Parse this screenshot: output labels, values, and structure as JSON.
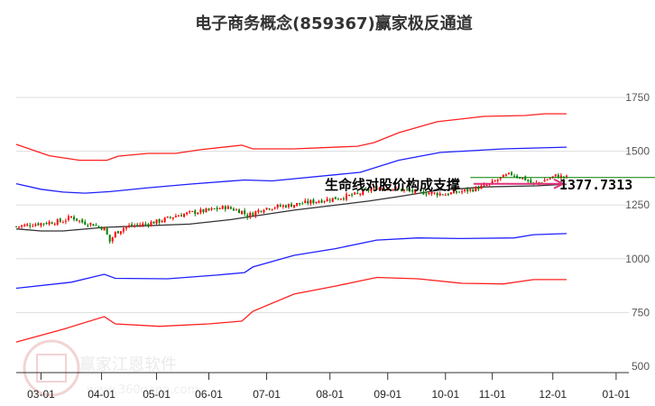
{
  "chart_data": {
    "type": "line",
    "title": "电子商务概念(859367)赢家极反通道",
    "x_unit": "trading day index",
    "x_ticks": [
      {
        "label": "03-01",
        "x": 9
      },
      {
        "label": "04-01",
        "x": 31
      },
      {
        "label": "05-01",
        "x": 51
      },
      {
        "label": "06-01",
        "x": 70
      },
      {
        "label": "07-01",
        "x": 91
      },
      {
        "label": "08-01",
        "x": 114
      },
      {
        "label": "09-01",
        "x": 135
      },
      {
        "label": "10-01",
        "x": 156
      },
      {
        "label": "11-01",
        "x": 173
      },
      {
        "label": "12-01",
        "x": 195
      },
      {
        "label": "01-01",
        "x": 218
      }
    ],
    "xlim": [
      0,
      222
    ],
    "y_ticks": [
      500,
      750,
      1000,
      1250,
      1500,
      1750
    ],
    "ylim": [
      500,
      1750
    ],
    "grid": true,
    "series": [
      {
        "name": "upper-red",
        "color": "#ff2020",
        "points": [
          [
            0,
            1532
          ],
          [
            12,
            1479
          ],
          [
            23,
            1458
          ],
          [
            33,
            1458
          ],
          [
            37,
            1477
          ],
          [
            48,
            1490
          ],
          [
            58,
            1490
          ],
          [
            67,
            1507
          ],
          [
            82,
            1528
          ],
          [
            86,
            1511
          ],
          [
            101,
            1511
          ],
          [
            124,
            1523
          ],
          [
            130,
            1540
          ],
          [
            139,
            1586
          ],
          [
            153,
            1637
          ],
          [
            170,
            1662
          ],
          [
            185,
            1666
          ],
          [
            192,
            1674
          ],
          [
            200,
            1674
          ]
        ]
      },
      {
        "name": "upper-blue",
        "color": "#2020ff",
        "points": [
          [
            0,
            1349
          ],
          [
            9,
            1323
          ],
          [
            17,
            1310
          ],
          [
            25,
            1305
          ],
          [
            34,
            1312
          ],
          [
            48,
            1330
          ],
          [
            63,
            1347
          ],
          [
            83,
            1366
          ],
          [
            93,
            1362
          ],
          [
            125,
            1402
          ],
          [
            139,
            1458
          ],
          [
            154,
            1494
          ],
          [
            177,
            1511
          ],
          [
            200,
            1519
          ]
        ]
      },
      {
        "name": "mid-black",
        "color": "#333333",
        "points": [
          [
            0,
            1139
          ],
          [
            9,
            1129
          ],
          [
            17,
            1129
          ],
          [
            32,
            1146
          ],
          [
            63,
            1161
          ],
          [
            78,
            1182
          ],
          [
            101,
            1226
          ],
          [
            128,
            1268
          ],
          [
            139,
            1289
          ],
          [
            153,
            1318
          ],
          [
            170,
            1334
          ],
          [
            189,
            1339
          ],
          [
            200,
            1347
          ]
        ]
      },
      {
        "name": "lower-blue",
        "color": "#2020ff",
        "points": [
          [
            0,
            863
          ],
          [
            20,
            891
          ],
          [
            32,
            928
          ],
          [
            36,
            909
          ],
          [
            55,
            907
          ],
          [
            73,
            924
          ],
          [
            83,
            936
          ],
          [
            86,
            962
          ],
          [
            101,
            1016
          ],
          [
            116,
            1047
          ],
          [
            131,
            1087
          ],
          [
            146,
            1097
          ],
          [
            162,
            1094
          ],
          [
            181,
            1097
          ],
          [
            188,
            1112
          ],
          [
            200,
            1117
          ]
        ]
      },
      {
        "name": "lower-red",
        "color": "#ff2020",
        "points": [
          [
            0,
            613
          ],
          [
            17,
            672
          ],
          [
            32,
            731
          ],
          [
            36,
            697
          ],
          [
            52,
            686
          ],
          [
            70,
            697
          ],
          [
            82,
            710
          ],
          [
            86,
            756
          ],
          [
            101,
            836
          ],
          [
            116,
            873
          ],
          [
            131,
            913
          ],
          [
            146,
            907
          ],
          [
            162,
            886
          ],
          [
            177,
            883
          ],
          [
            188,
            903
          ],
          [
            200,
            903
          ]
        ]
      },
      {
        "name": "price-close",
        "type": "candlestick",
        "up_color": "#ff0000",
        "down_color": "#008000",
        "points": [
          [
            0,
            1150
          ],
          [
            9,
            1165
          ],
          [
            17,
            1175
          ],
          [
            20,
            1195
          ],
          [
            24,
            1170
          ],
          [
            28,
            1160
          ],
          [
            32,
            1140
          ],
          [
            34,
            1080
          ],
          [
            36,
            1120
          ],
          [
            40,
            1150
          ],
          [
            46,
            1160
          ],
          [
            52,
            1175
          ],
          [
            58,
            1200
          ],
          [
            64,
            1215
          ],
          [
            70,
            1225
          ],
          [
            76,
            1240
          ],
          [
            82,
            1220
          ],
          [
            84,
            1200
          ],
          [
            90,
            1235
          ],
          [
            100,
            1250
          ],
          [
            110,
            1270
          ],
          [
            118,
            1285
          ],
          [
            124,
            1300
          ],
          [
            130,
            1330
          ],
          [
            136,
            1330
          ],
          [
            140,
            1320
          ],
          [
            146,
            1310
          ],
          [
            156,
            1300
          ],
          [
            165,
            1320
          ],
          [
            172,
            1345
          ],
          [
            176,
            1375
          ],
          [
            180,
            1395
          ],
          [
            185,
            1370
          ],
          [
            188,
            1345
          ],
          [
            192,
            1365
          ],
          [
            196,
            1385
          ],
          [
            200,
            1378
          ]
        ]
      }
    ],
    "support_line": {
      "value": 1377.7313,
      "color": "#008000",
      "label": "1377.7313"
    },
    "annotation": {
      "text": "生命线对股价构成支撑",
      "arrow_color": "#e0307a"
    }
  },
  "watermark": {
    "brand": "赢家江恩软件",
    "url": "www.360gann.com",
    "seal": "江赢恩家"
  }
}
